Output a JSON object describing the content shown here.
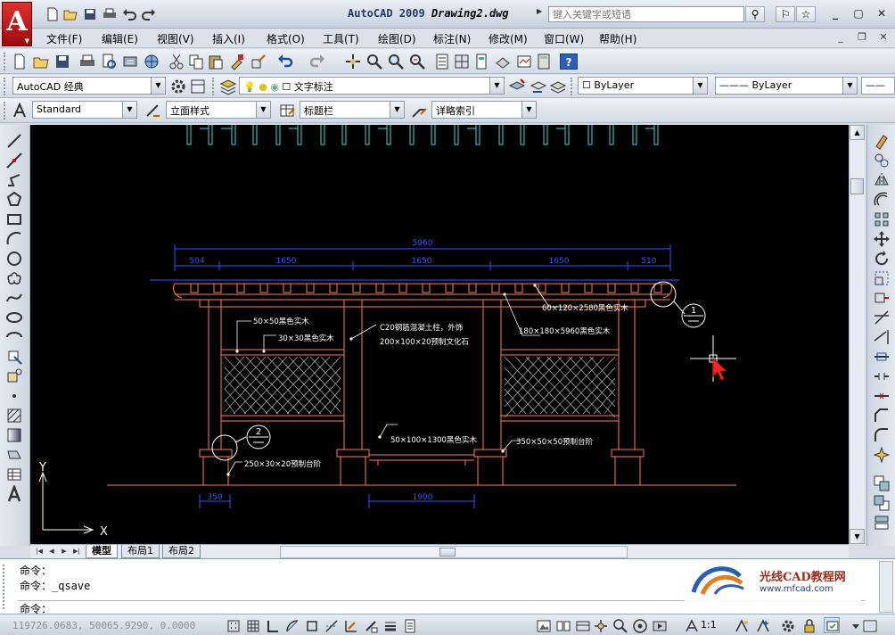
{
  "window": {
    "title_app": "AutoCAD 2009",
    "title_doc": "Drawing2.dwg",
    "search_placeholder": "键入关键字或短语"
  },
  "menu": [
    "文件(F)",
    "编辑(E)",
    "视图(V)",
    "插入(I)",
    "格式(O)",
    "工具(T)",
    "绘图(D)",
    "标注(N)",
    "修改(M)",
    "窗口(W)",
    "帮助(H)"
  ],
  "toolbar": {
    "workspace": "AutoCAD 经典",
    "layer": "文字标注",
    "color": "ByLayer",
    "linetype": "ByLayer",
    "text_style": "Standard",
    "dim_style": "立面样式",
    "table_style": "标题栏",
    "multileader_style": "详略索引"
  },
  "drawing": {
    "dims_top": {
      "overall": "5960",
      "segments": [
        "504",
        "1650",
        "1650",
        "1650",
        "510"
      ]
    },
    "dims_bottom": {
      "left": "350",
      "middle": "1900"
    },
    "notes": {
      "n1": "50×50黑色实木",
      "n2": "30×30黑色实木",
      "n3": "C20钢筋混凝土柱，外饰",
      "n4": "200×100×20预制文化石",
      "n5": "60×120×2580黑色实木",
      "n6": "180×180×5960黑色实木",
      "n7": "50×100×1300黑色实木",
      "n8": "350×50×50预制台阶",
      "n9": "250×30×20预制台阶"
    },
    "callouts": {
      "c1": "1",
      "c2": "2"
    },
    "ucs_x": "X",
    "ucs_y": "Y"
  },
  "tabs": [
    "模型",
    "布局1",
    "布局2"
  ],
  "command": {
    "line1": "命令：",
    "line2": "命令：_qsave",
    "prompt": "命令："
  },
  "status": {
    "coords": "119726.0683,  50065.9290,  0.0000",
    "scale": "1:1"
  },
  "watermark": {
    "title": "光线CAD教程网",
    "url": "www.mfcad.com"
  },
  "colors": {
    "canvas_bg": "#000000",
    "structure": "#ff7a52",
    "dimension": "#3a50ff",
    "text": "#ffffff",
    "top_detail": "#3fd6d6",
    "hatch": "#c0c0c0",
    "cursor": "#ff0000"
  }
}
